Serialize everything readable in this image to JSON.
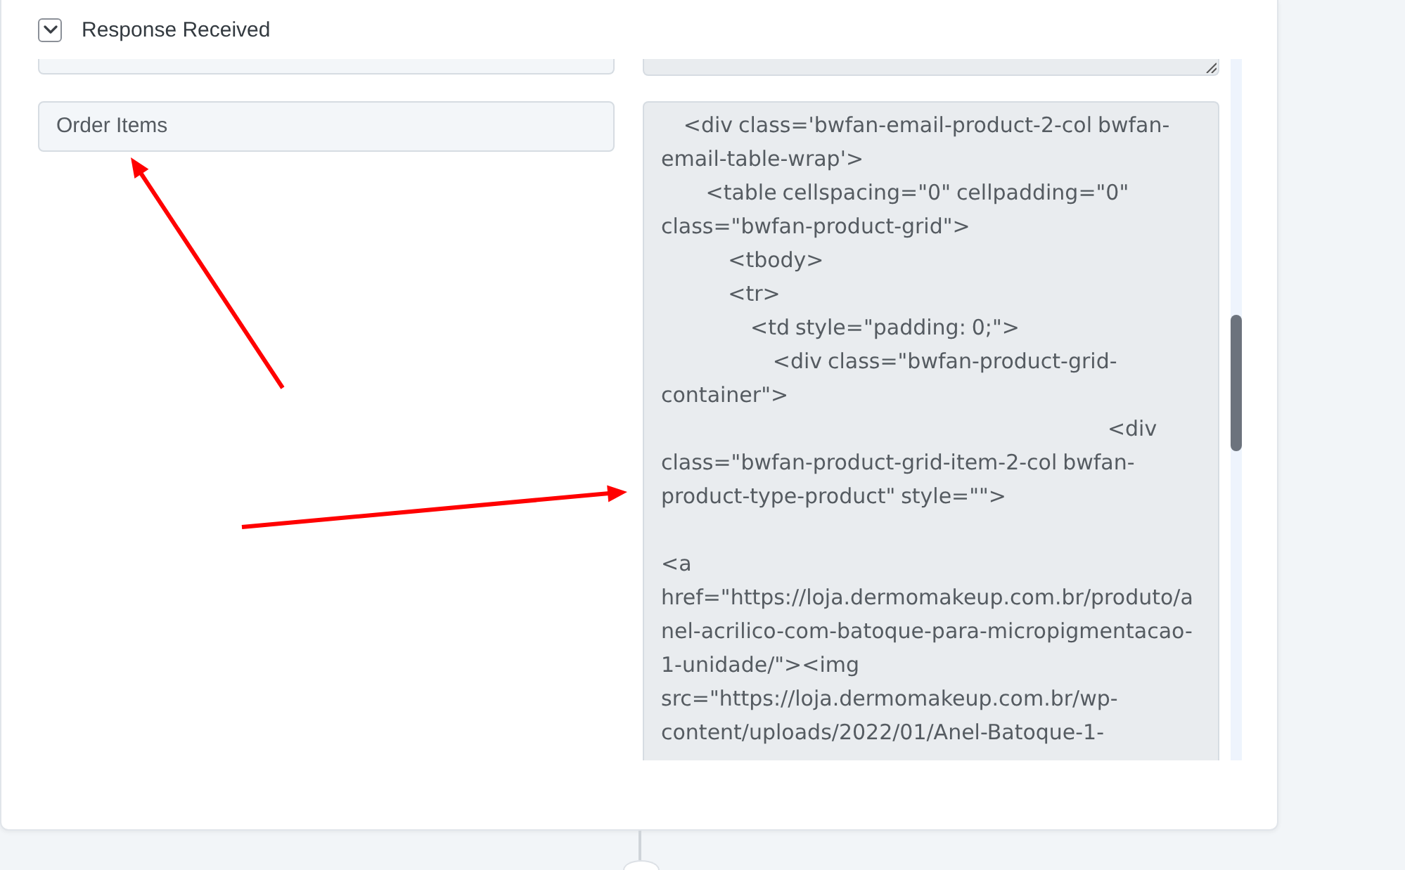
{
  "section": {
    "title": "Response Received",
    "expanded": true
  },
  "rows": [
    {
      "kind": "clipped"
    },
    {
      "kind": "full",
      "key": "Order Items",
      "value": "    <div class='bwfan-email-product-2-col bwfan-email-table-wrap'>\n        <table cellspacing=\"0\" cellpadding=\"0\" class=\"bwfan-product-grid\">\n            <tbody>\n            <tr>\n                <td style=\"padding: 0;\">\n                    <div class=\"bwfan-product-grid-container\">\n                                                                                <div class=\"bwfan-product-grid-item-2-col bwfan-product-type-product\" style=\"\">\n\n<a href=\"https://loja.dermomakeup.com.br/produto/anel-acrilico-com-batoque-para-micropigmentacao-1-unidade/\"><img src=\"https://loja.dermomakeup.com.br/wp-content/uploads/2022/01/Anel-Batoque-1-"
    }
  ]
}
